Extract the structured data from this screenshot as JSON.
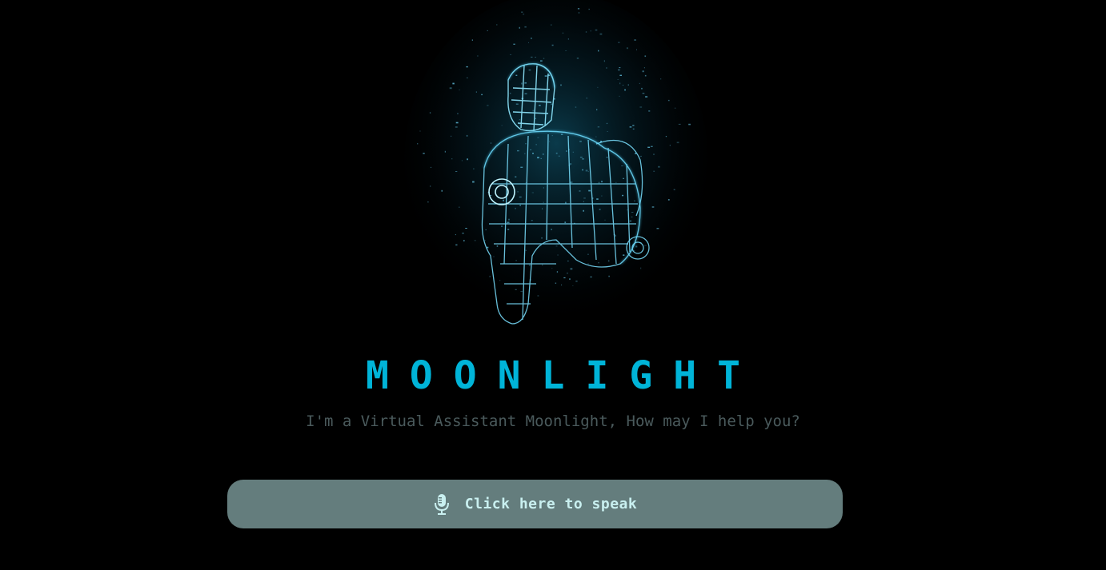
{
  "app": {
    "title": "MOONLIGHT",
    "subtitle": "I'm a Virtual Assistant Moonlight, How may I help you?"
  },
  "hero": {
    "icon": "hologram-armor-figure"
  },
  "speak_button": {
    "label": "Click here to speak",
    "icon": "microphone-icon"
  },
  "colors": {
    "background": "#000000",
    "accent": "#00b4d8",
    "subtitle": "#4a5a5c",
    "button_bg": "#647d7d",
    "button_text": "#c9f0f0",
    "hologram": "#4fd6ff"
  }
}
